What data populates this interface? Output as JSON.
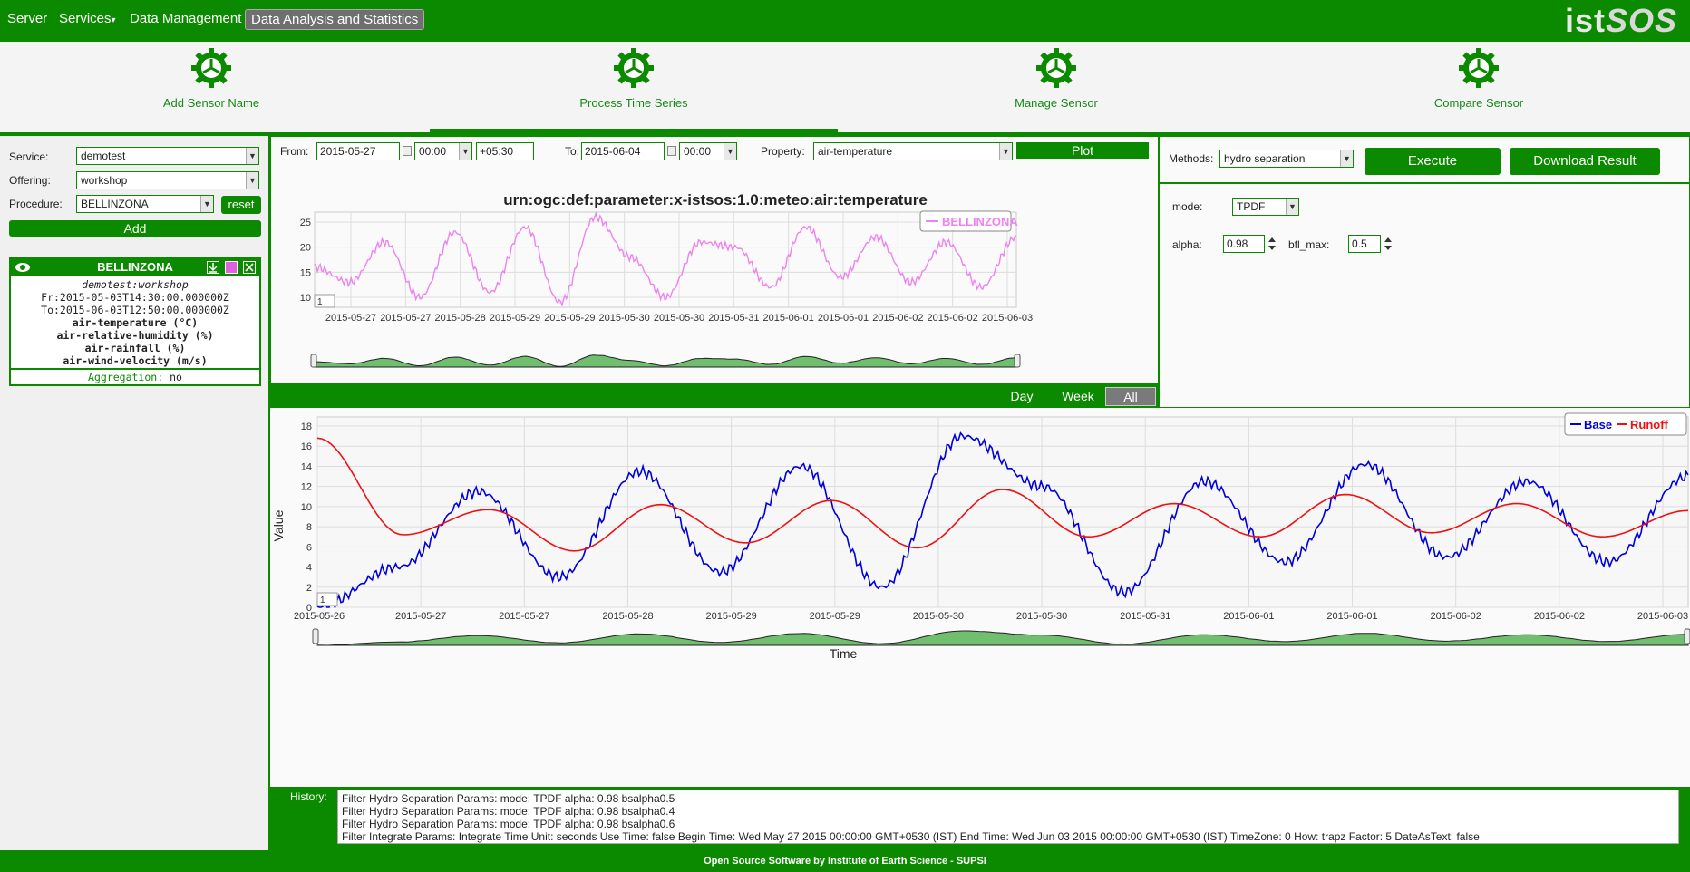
{
  "nav": {
    "items": [
      "Server",
      "Services",
      "Data Management",
      "Data Analysis and Statistics"
    ],
    "services_caret": "▾",
    "logo_ist": "ist",
    "logo_sos": "SOS"
  },
  "iconbar": {
    "items": [
      "Add Sensor Name",
      "Process Time Series",
      "Manage Sensor",
      "Compare Sensor"
    ]
  },
  "left": {
    "service_label": "Service:",
    "service_value": "demotest",
    "offering_label": "Offering:",
    "offering_value": "workshop",
    "procedure_label": "Procedure:",
    "procedure_value": "BELLINZONA",
    "reset_label": "reset",
    "add_label": "Add",
    "sensor": {
      "name": "BELLINZONA",
      "swatch_color": "#e060e0",
      "service_offering": "demotest:workshop",
      "from": "Fr:2015-05-03T14:30:00.000000Z",
      "to": "To:2015-06-03T12:50:00.000000Z",
      "properties": [
        "air-temperature (°C)",
        "air-relative-humidity (%)",
        "air-rainfall (%)",
        "air-wind-velocity (m/s)"
      ],
      "aggregation_label": "Aggregation:",
      "aggregation_value": "no"
    }
  },
  "query": {
    "from_label": "From:",
    "from_date": "2015-05-27",
    "from_time": "00:00",
    "tz": "+05:30",
    "to_label": "To:",
    "to_date": "2015-06-04",
    "to_time": "00:00",
    "property_label": "Property:",
    "property_value": "air-temperature",
    "plot_label": "Plot"
  },
  "top_chart": {
    "title": "urn:ogc:def:parameter:x-istsos:1.0:meteo:air:temperature",
    "legend": "BELLINZONA",
    "y_ticks": [
      "25",
      "20",
      "15",
      "10"
    ],
    "x_ticks": [
      "2015-05-27",
      "2015-05-27",
      "2015-05-28",
      "2015-05-29",
      "2015-05-29",
      "2015-05-30",
      "2015-05-30",
      "2015-05-31",
      "2015-06-01",
      "2015-06-01",
      "2015-06-02",
      "2015-06-02",
      "2015-06-03"
    ],
    "corner_box": "1",
    "range_buttons": [
      "Day",
      "Week",
      "All"
    ],
    "active_range": "All",
    "line_color": "#ee82ee"
  },
  "methods": {
    "methods_label": "Methods:",
    "methods_value": "hydro separation",
    "execute_label": "Execute",
    "download_label": "Download Result",
    "mode_label": "mode:",
    "mode_value": "TPDF",
    "alpha_label": "alpha:",
    "alpha_value": "0.98",
    "bfl_label": "bfl_max:",
    "bfl_value": "0.5"
  },
  "main_chart": {
    "ylabel": "Value",
    "xlabel": "Time",
    "y_ticks": [
      "18",
      "16",
      "14",
      "12",
      "10",
      "8",
      "6",
      "4",
      "2",
      "0"
    ],
    "x_ticks": [
      "2015-05-26",
      "2015-05-27",
      "2015-05-27",
      "2015-05-28",
      "2015-05-29",
      "2015-05-29",
      "2015-05-30",
      "2015-05-30",
      "2015-05-31",
      "2015-06-01",
      "2015-06-01",
      "2015-06-02",
      "2015-06-02",
      "2015-06-03"
    ],
    "legend_base": "Base",
    "legend_runoff": "Runoff",
    "base_color": "#0000dd",
    "runoff_color": "#ee1111",
    "corner_box": "1"
  },
  "chart_data": [
    {
      "type": "line",
      "title": "urn:ogc:def:parameter:x-istsos:1.0:meteo:air:temperature",
      "xlabel": "",
      "ylabel": "",
      "x": [
        "2015-05-27",
        "2015-05-27",
        "2015-05-28",
        "2015-05-29",
        "2015-05-29",
        "2015-05-30",
        "2015-05-30",
        "2015-05-31",
        "2015-06-01",
        "2015-06-01",
        "2015-06-02",
        "2015-06-02",
        "2015-06-03"
      ],
      "series": [
        {
          "name": "BELLINZONA",
          "values": [
            16,
            13,
            21,
            10,
            23,
            11,
            24,
            9,
            26,
            18,
            10,
            21,
            20,
            12,
            24,
            14,
            22,
            13,
            21,
            12,
            22
          ]
        }
      ],
      "ylim": [
        8,
        27
      ],
      "grid": true,
      "legend": "top-right"
    },
    {
      "type": "line",
      "title": "",
      "xlabel": "Time",
      "ylabel": "Value",
      "x": [
        "2015-05-26",
        "2015-05-27",
        "2015-05-27",
        "2015-05-28",
        "2015-05-29",
        "2015-05-29",
        "2015-05-30",
        "2015-05-30",
        "2015-05-31",
        "2015-06-01",
        "2015-06-01",
        "2015-06-02",
        "2015-06-02",
        "2015-06-03"
      ],
      "series": [
        {
          "name": "Base",
          "values": [
            0,
            4,
            11.5,
            3,
            13.5,
            3.5,
            14,
            2,
            17,
            12,
            1.5,
            12.5,
            4.5,
            14.2,
            5,
            12.5,
            4.5,
            13
          ]
        },
        {
          "name": "Runoff",
          "values": [
            16.8,
            7.2,
            9.7,
            5.6,
            10.2,
            6.4,
            10.6,
            5.9,
            11.7,
            7.0,
            10.3,
            7.0,
            11.2,
            7.4,
            10.3,
            7.0,
            9.6
          ]
        }
      ],
      "ylim": [
        0,
        18
      ],
      "grid": true,
      "legend": "top-right"
    }
  ],
  "history": {
    "label": "History:",
    "lines": [
      "Filter Hydro Separation Params:  mode: TPDF  alpha: 0.98  bsalpha0.5",
      "Filter Hydro Separation Params:  mode: TPDF  alpha: 0.98  bsalpha0.4",
      "Filter Hydro Separation Params:  mode: TPDF  alpha: 0.98  bsalpha0.6",
      "Filter Integrate Params:  Integrate Time Unit: seconds  Use Time: false  Begin Time: Wed May 27 2015 00:00:00 GMT+0530 (IST)  End Time: Wed Jun 03 2015 00:00:00 GMT+0530 (IST)  TimeZone: 0  How: trapz  Factor: 5   DateAsText: false"
    ]
  },
  "footer": "Open Source Software by Institute of Earth Science - SUPSI"
}
